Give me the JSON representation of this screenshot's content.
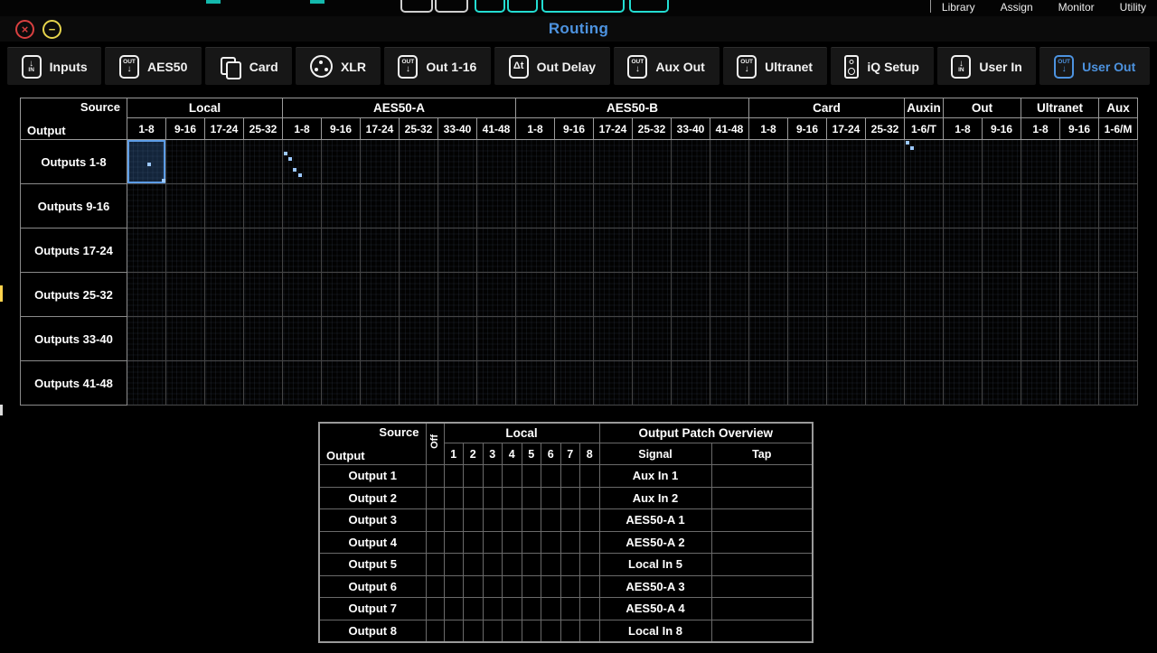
{
  "topbar": {
    "menu_items": [
      "Library",
      "Assign",
      "Monitor",
      "Utility"
    ]
  },
  "titlebar": {
    "title": "Routing",
    "close_glyph": "×",
    "minimize_glyph": "−"
  },
  "tabs": [
    {
      "label": "Inputs",
      "icon": "in",
      "selected": false
    },
    {
      "label": "AES50",
      "icon": "out",
      "selected": false
    },
    {
      "label": "Card",
      "icon": "card",
      "selected": false
    },
    {
      "label": "XLR",
      "icon": "xlr",
      "selected": false
    },
    {
      "label": "Out 1-16",
      "icon": "out",
      "selected": false
    },
    {
      "label": "Out Delay",
      "icon": "delay",
      "selected": false
    },
    {
      "label": "Aux Out",
      "icon": "out",
      "selected": false
    },
    {
      "label": "Ultranet",
      "icon": "out",
      "selected": false
    },
    {
      "label": "iQ Setup",
      "icon": "speaker",
      "selected": false
    },
    {
      "label": "User In",
      "icon": "in",
      "selected": false
    },
    {
      "label": "User Out",
      "icon": "out",
      "selected": true
    }
  ],
  "matrix": {
    "corner": {
      "source_label": "Source",
      "output_label": "Output"
    },
    "groups": [
      {
        "label": "Local",
        "cols": [
          "1-8",
          "9-16",
          "17-24",
          "25-32"
        ]
      },
      {
        "label": "AES50-A",
        "cols": [
          "1-8",
          "9-16",
          "17-24",
          "25-32",
          "33-40",
          "41-48"
        ]
      },
      {
        "label": "AES50-B",
        "cols": [
          "1-8",
          "9-16",
          "17-24",
          "25-32",
          "33-40",
          "41-48"
        ]
      },
      {
        "label": "Card",
        "cols": [
          "1-8",
          "9-16",
          "17-24",
          "25-32"
        ]
      },
      {
        "label": "Auxin",
        "cols": [
          "1-6/T"
        ]
      },
      {
        "label": "Out",
        "cols": [
          "1-8",
          "9-16"
        ]
      },
      {
        "label": "Ultranet",
        "cols": [
          "1-8",
          "9-16"
        ]
      },
      {
        "label": "Aux",
        "cols": [
          "1-6/M"
        ]
      }
    ],
    "rows": [
      "Outputs 1-8",
      "Outputs 9-16",
      "Outputs 17-24",
      "Outputs 25-32",
      "Outputs 33-40",
      "Outputs 41-48"
    ],
    "selected_cell": {
      "row": 0,
      "col": 0
    },
    "patch_dots": [
      {
        "row": 0,
        "col": 0,
        "points": [
          [
            5,
            5
          ],
          [
            8,
            8
          ]
        ]
      },
      {
        "row": 0,
        "col": 4,
        "points": [
          [
            1,
            3
          ],
          [
            2,
            4
          ],
          [
            3,
            6
          ],
          [
            4,
            7
          ]
        ]
      },
      {
        "row": 0,
        "col": 20,
        "points": [
          [
            1,
            1
          ],
          [
            2,
            2
          ]
        ]
      }
    ]
  },
  "overview": {
    "corner": {
      "source_label": "Source",
      "output_label": "Output"
    },
    "off_label": "Off",
    "local_label": "Local",
    "title": "Output  Patch Overview",
    "channel_cols": [
      "1",
      "2",
      "3",
      "4",
      "5",
      "6",
      "7",
      "8"
    ],
    "signal_header": "Signal",
    "tap_header": "Tap",
    "rows": [
      {
        "output": "Output 1",
        "signal": "Aux In 1",
        "tap": "",
        "selected_col": null
      },
      {
        "output": "Output 2",
        "signal": "Aux In 2",
        "tap": "",
        "selected_col": null
      },
      {
        "output": "Output 3",
        "signal": "AES50-A 1",
        "tap": "",
        "selected_col": null
      },
      {
        "output": "Output 4",
        "signal": "AES50-A 2",
        "tap": "",
        "selected_col": null
      },
      {
        "output": "Output 5",
        "signal": "Local In 5",
        "tap": "",
        "selected_col": 5
      },
      {
        "output": "Output 6",
        "signal": "AES50-A 3",
        "tap": "",
        "selected_col": null
      },
      {
        "output": "Output 7",
        "signal": "AES50-A 4",
        "tap": "",
        "selected_col": null
      },
      {
        "output": "Output 8",
        "signal": "Local In 8",
        "tap": "",
        "selected_col": 8
      }
    ]
  },
  "colors": {
    "accent_blue": "#4d93e0",
    "patch_cell_blue": "#3c5c80",
    "patch_highlight_blue": "#62a8e8",
    "dot_blue": "#9cc8ff",
    "teal": "#23ddd2",
    "close_red": "#d94040",
    "minimize_yellow": "#e6d44c"
  }
}
